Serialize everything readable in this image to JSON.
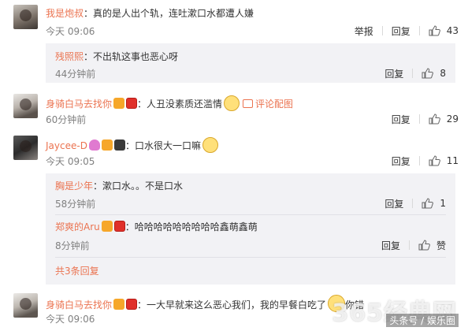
{
  "comments": [
    {
      "username": "我是炮叔",
      "text": "真的是人出个轨，连吐漱口水都遭人嫌",
      "time": "今天 09:06",
      "report": "举报",
      "reply": "回复",
      "likes": "43",
      "replies": [
        {
          "username": "残照熙",
          "text": "不出轨这事也恶心呀",
          "time": "44分钟前",
          "reply": "回复",
          "likes": "8"
        }
      ]
    },
    {
      "username": "身骑白马去找你",
      "text": "人丑没素质还滥情",
      "link": "评论配图",
      "time": "60分钟前",
      "reply": "回复",
      "likes": "29"
    },
    {
      "username": "Jaycee-D",
      "text": "口水很大一口嘛",
      "time": "今天 09:05",
      "reply": "回复",
      "likes": "11",
      "replies": [
        {
          "username": "胸是少年",
          "text": "漱口水。。不是口水",
          "time": "58分钟前",
          "reply": "回复",
          "likes": "1"
        },
        {
          "username": "郑爽的Aru",
          "text": "哈哈哈哈哈哈哈哈哈鑫萌鑫萌",
          "time": "8分钟前",
          "reply": "回复",
          "likes": "赞"
        }
      ],
      "more": "共3条回复"
    },
    {
      "username": "身骑白马去找你",
      "text": "一大早就来这么恶心我们，我的早餐白吃了",
      "text_tail": "你错",
      "time": "今天 09:06"
    }
  ],
  "watermark": "365经典网",
  "credit": "头条号 / 娱乐圈"
}
